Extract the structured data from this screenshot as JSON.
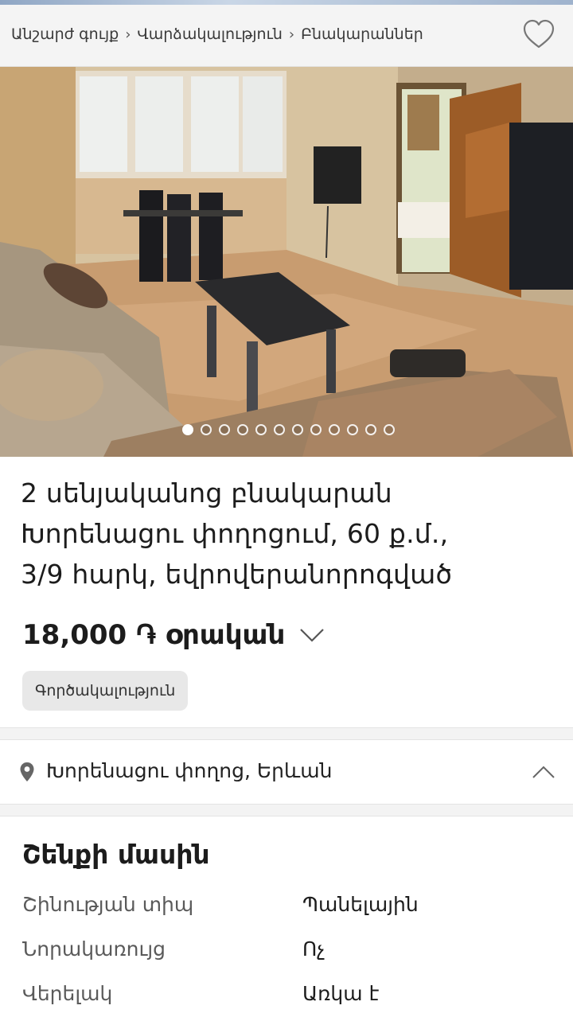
{
  "breadcrumb": [
    "Անշարժ գույք",
    "Վարձակալություն",
    "Բնակարաններ"
  ],
  "breadcrumb_separator": "›",
  "gallery": {
    "image_count": 12,
    "active_index": 0
  },
  "listing": {
    "title_lines": [
      "2 սենյականոց բնակարան",
      "Խորենացու փողոցում, 60 ք.մ.,",
      "3/9 հարկ, եվրովերանորոգված"
    ],
    "price": "18,000 ֏ օրական",
    "category": "Գործակալություն",
    "location": "Խորենացու փողոց, Երևան"
  },
  "building": {
    "title": "Շենքի մասին",
    "specs": [
      {
        "label": "Շինության տիպ",
        "value": "Պանելային"
      },
      {
        "label": "Նորակառույց",
        "value": "Ոչ"
      },
      {
        "label": "Վերելակ",
        "value": "Առկա է"
      }
    ]
  },
  "icons": [
    "heart-icon",
    "chevron-down-icon",
    "location-pin-icon",
    "chevron-up-icon"
  ],
  "colors": {
    "header_bg": "#f4f4f4",
    "chip_bg": "#e8e8e8",
    "separator_bg": "#f3f3f3"
  }
}
